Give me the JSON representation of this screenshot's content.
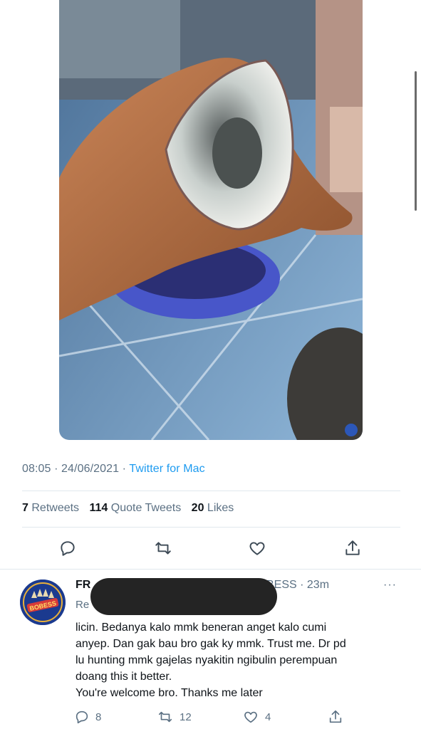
{
  "tweet": {
    "timestamp": "08:05 · 24/06/2021 ·",
    "client": "Twitter for Mac",
    "stats": {
      "retweets_count": "7",
      "retweets_label": "Retweets",
      "quotes_count": "114",
      "quotes_label": "Quote Tweets",
      "likes_count": "20",
      "likes_label": "Likes"
    },
    "actions": [
      "reply-icon",
      "retweet-icon",
      "like-icon",
      "share-icon"
    ]
  },
  "reply": {
    "name_prefix": "FR",
    "handle_suffix": "BESS · 23m",
    "reply_to_prefix": "Re",
    "more": "···",
    "avatar_text": "BOBESS",
    "body": [
      "licin. Bedanya kalo mmk beneran anget kalo cumi",
      "anyep. Dan gak bau bro gak ky mmk. Trust me. Dr pd",
      "lu hunting mmk gajelas nyakitin ngibulin perempuan",
      "doang this it better.",
      "You're welcome bro. Thanks me later"
    ],
    "counts": {
      "replies": "8",
      "retweets": "12",
      "likes": "4"
    }
  },
  "colors": {
    "accent": "#1d9bf0",
    "muted": "#5b7083",
    "text": "#0f1419"
  }
}
